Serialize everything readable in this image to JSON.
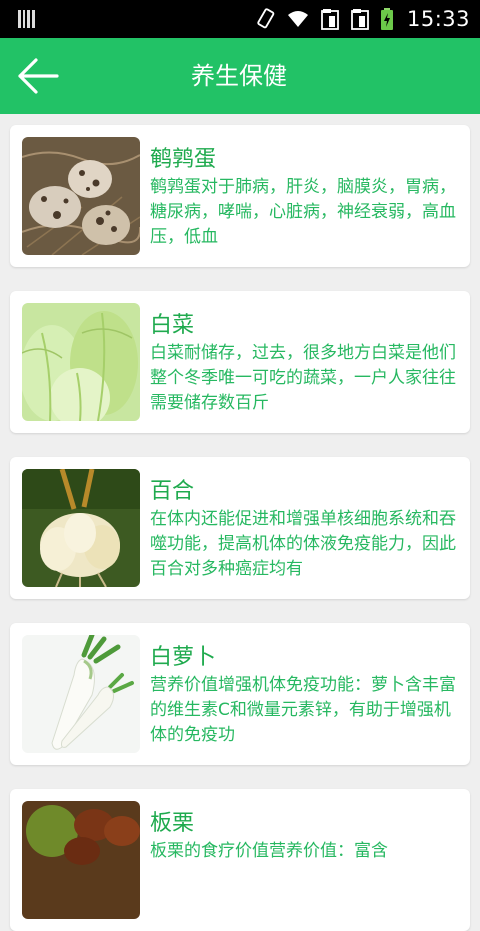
{
  "status_bar": {
    "time": "15:33",
    "icons": [
      "barcode-icon",
      "rotate-phone-icon",
      "wifi-icon",
      "sim1-icon",
      "sim2-icon",
      "battery-charging-icon"
    ]
  },
  "header": {
    "title": "养生保健",
    "back_icon": "back-arrow-icon"
  },
  "colors": {
    "accent": "#22c266",
    "text_green": "#27b861",
    "title_green": "#1faa4e"
  },
  "items": [
    {
      "name": "鹌鹑蛋",
      "desc": "鹌鹑蛋对于肺病，肝炎，脑膜炎，胃病，糖尿病，哮喘，心脏病，神经衰弱，高血压，低血"
    },
    {
      "name": "白菜",
      "desc": "白菜耐储存，过去，很多地方白菜是他们整个冬季唯一可吃的蔬菜，一户人家往往需要储存数百斤"
    },
    {
      "name": "百合",
      "desc": "在体内还能促进和增强单核细胞系统和吞噬功能，提高机体的体液免疫能力，因此百合对多种癌症均有"
    },
    {
      "name": "白萝卜",
      "desc": "营养价值增强机体免疫功能：萝卜含丰富的维生素C和微量元素锌，有助于增强机体的免疫功"
    },
    {
      "name": "板栗",
      "desc": "板栗的食疗价值营养价值：富含"
    }
  ]
}
